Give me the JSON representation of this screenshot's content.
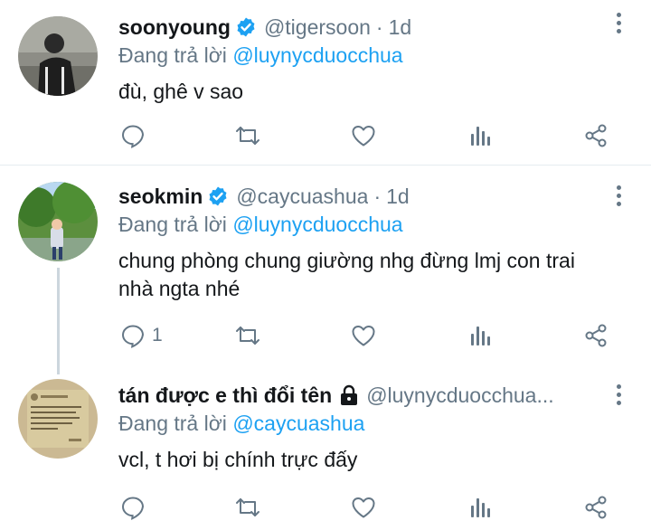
{
  "reply_prefix": "Đang trả lời",
  "tweets": [
    {
      "name": "soonyoung",
      "verified": true,
      "handle": "@tigersoon",
      "dot": "·",
      "time": "1d",
      "reply_to": "@luynycduocchua",
      "text": "đù, ghê v sao",
      "reply_count": ""
    },
    {
      "name": "seokmin",
      "verified": true,
      "handle": "@caycuashua",
      "dot": "·",
      "time": "1d",
      "reply_to": "@luynycduocchua",
      "text": "chung phòng chung giường nhg đừng lmj con trai nhà ngta nhé",
      "reply_count": "1"
    },
    {
      "name": "tán được e thì đổi tên",
      "locked": true,
      "handle": "@luynycduocchua...",
      "reply_to": "@caycuashua",
      "text": "vcl, t hơi bị chính trực đấy",
      "reply_count": ""
    }
  ],
  "icons": {
    "reply": "reply-icon",
    "retweet": "retweet-icon",
    "like": "like-icon",
    "analytics": "analytics-icon",
    "share": "share-icon",
    "more": "more-vertical-icon",
    "verified": "verified-badge-icon",
    "lock": "lock-icon"
  },
  "colors": {
    "accent": "#1da1f2",
    "muted": "#657786",
    "text": "#14171a",
    "divider": "#e6ecf0"
  }
}
